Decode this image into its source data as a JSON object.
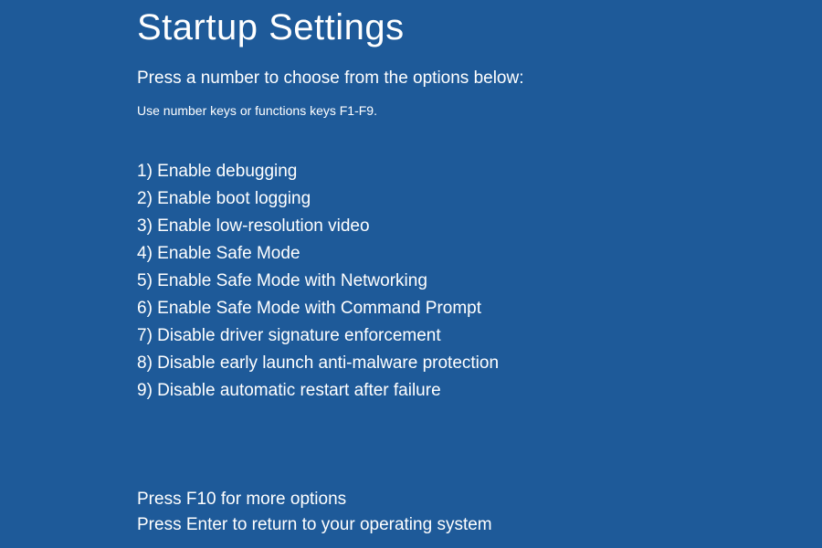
{
  "title": "Startup Settings",
  "instruction": "Press a number to choose from the options below:",
  "hint": "Use number keys or functions keys F1-F9.",
  "options": [
    "1) Enable debugging",
    "2) Enable boot logging",
    "3) Enable low-resolution video",
    "4) Enable Safe Mode",
    "5) Enable Safe Mode with Networking",
    "6) Enable Safe Mode with Command Prompt",
    "7) Disable driver signature enforcement",
    "8) Disable early launch anti-malware protection",
    "9) Disable automatic restart after failure"
  ],
  "footer": {
    "more_options": "Press F10 for more options",
    "return_os": "Press Enter to return to your operating system"
  }
}
